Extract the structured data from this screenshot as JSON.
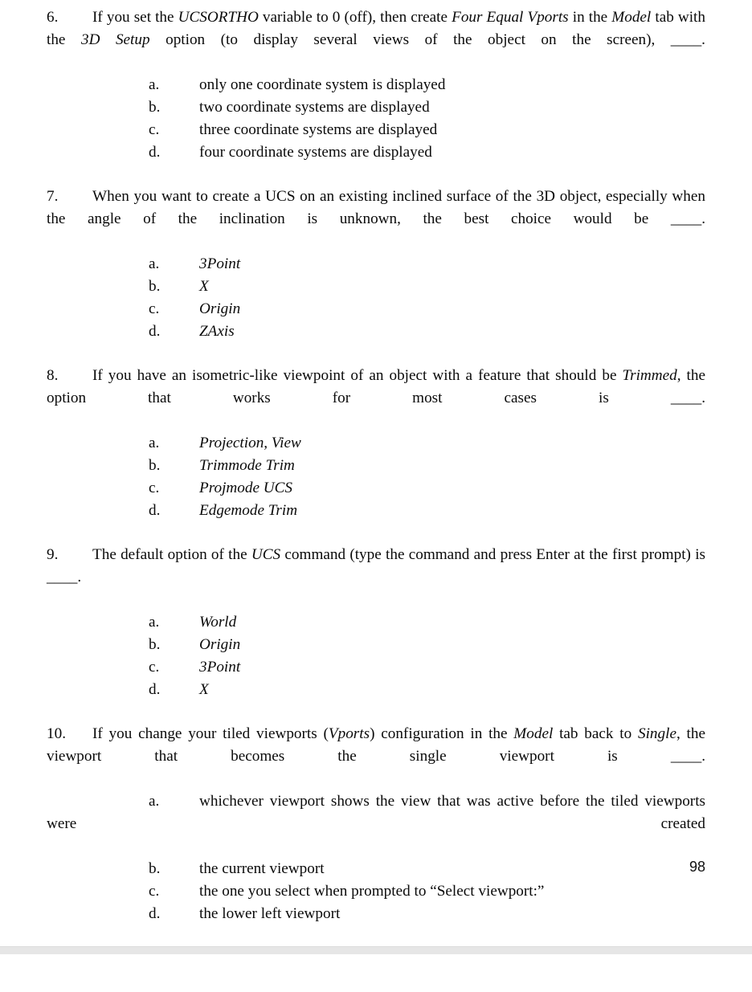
{
  "page": {
    "number": "98",
    "background_color": "#ffffff",
    "text_color": "#0a0a0a",
    "separator_color": "#e6e6e6"
  },
  "questions": [
    {
      "number": "6.",
      "stem_parts": [
        {
          "text": "If you set the ",
          "italic": false
        },
        {
          "text": "UCSORTHO",
          "italic": true
        },
        {
          "text": " variable to 0 (off), then create ",
          "italic": false
        },
        {
          "text": "Four Equal Vports",
          "italic": true
        },
        {
          "text": " in the ",
          "italic": false
        },
        {
          "text": "Model",
          "italic": true
        },
        {
          "text": " tab with the ",
          "italic": false
        },
        {
          "text": "3D Setup",
          "italic": true
        },
        {
          "text": " option (to display several views of the object on the screen), ____.",
          "italic": false
        }
      ],
      "options_italic": false,
      "options": [
        {
          "letter": "a.",
          "text": "only one coordinate system is displayed"
        },
        {
          "letter": "b.",
          "text": "two coordinate systems are displayed"
        },
        {
          "letter": "c.",
          "text": "three coordinate systems are displayed"
        },
        {
          "letter": "d.",
          "text": "four coordinate systems are displayed"
        }
      ]
    },
    {
      "number": "7.",
      "stem_parts": [
        {
          "text": "When you want to create a UCS on an existing inclined surface of the 3D object, especially when the angle of the inclination is unknown, the best choice would be ____.",
          "italic": false
        }
      ],
      "options_italic": true,
      "options": [
        {
          "letter": "a.",
          "text": "3Point"
        },
        {
          "letter": "b.",
          "text": "X"
        },
        {
          "letter": "c.",
          "text": "Origin"
        },
        {
          "letter": "d.",
          "text": "ZAxis"
        }
      ]
    },
    {
      "number": "8.",
      "stem_parts": [
        {
          "text": "If you have an isometric-like viewpoint of an object with a feature that should be ",
          "italic": false
        },
        {
          "text": "Trimmed",
          "italic": true
        },
        {
          "text": ", the option that works for most cases is ____.",
          "italic": false
        }
      ],
      "options_italic": true,
      "options": [
        {
          "letter": "a.",
          "text": "Projection, View"
        },
        {
          "letter": "b.",
          "text": "Trimmode Trim"
        },
        {
          "letter": "c.",
          "text": "Projmode UCS"
        },
        {
          "letter": "d.",
          "text": "Edgemode Trim"
        }
      ]
    },
    {
      "number": "9.",
      "stem_parts": [
        {
          "text": "The default option of the ",
          "italic": false
        },
        {
          "text": "UCS",
          "italic": true
        },
        {
          "text": " command (type the command and press Enter at the first prompt) is ____.",
          "italic": false
        }
      ],
      "options_italic": true,
      "options": [
        {
          "letter": "a.",
          "text": "World"
        },
        {
          "letter": "b.",
          "text": "Origin"
        },
        {
          "letter": "c.",
          "text": "3Point"
        },
        {
          "letter": "d.",
          "text": "X"
        }
      ]
    },
    {
      "number": "10.",
      "stem_parts": [
        {
          "text": "If you change your tiled viewports (",
          "italic": false
        },
        {
          "text": "Vports",
          "italic": true
        },
        {
          "text": ") configuration in the ",
          "italic": false
        },
        {
          "text": "Model",
          "italic": true
        },
        {
          "text": " tab back to ",
          "italic": false
        },
        {
          "text": "Single",
          "italic": true
        },
        {
          "text": ", the viewport that becomes the single viewport is ____.",
          "italic": false
        }
      ],
      "options_italic": false,
      "options": [
        {
          "letter": "a.",
          "text": "whichever viewport shows the view that was active before the tiled viewports were created",
          "wraps": true
        },
        {
          "letter": "b.",
          "text": "the current viewport"
        },
        {
          "letter": "c.",
          "text": "the one you select when prompted to “Select viewport:”"
        },
        {
          "letter": "d.",
          "text": "the lower left viewport"
        }
      ]
    }
  ]
}
